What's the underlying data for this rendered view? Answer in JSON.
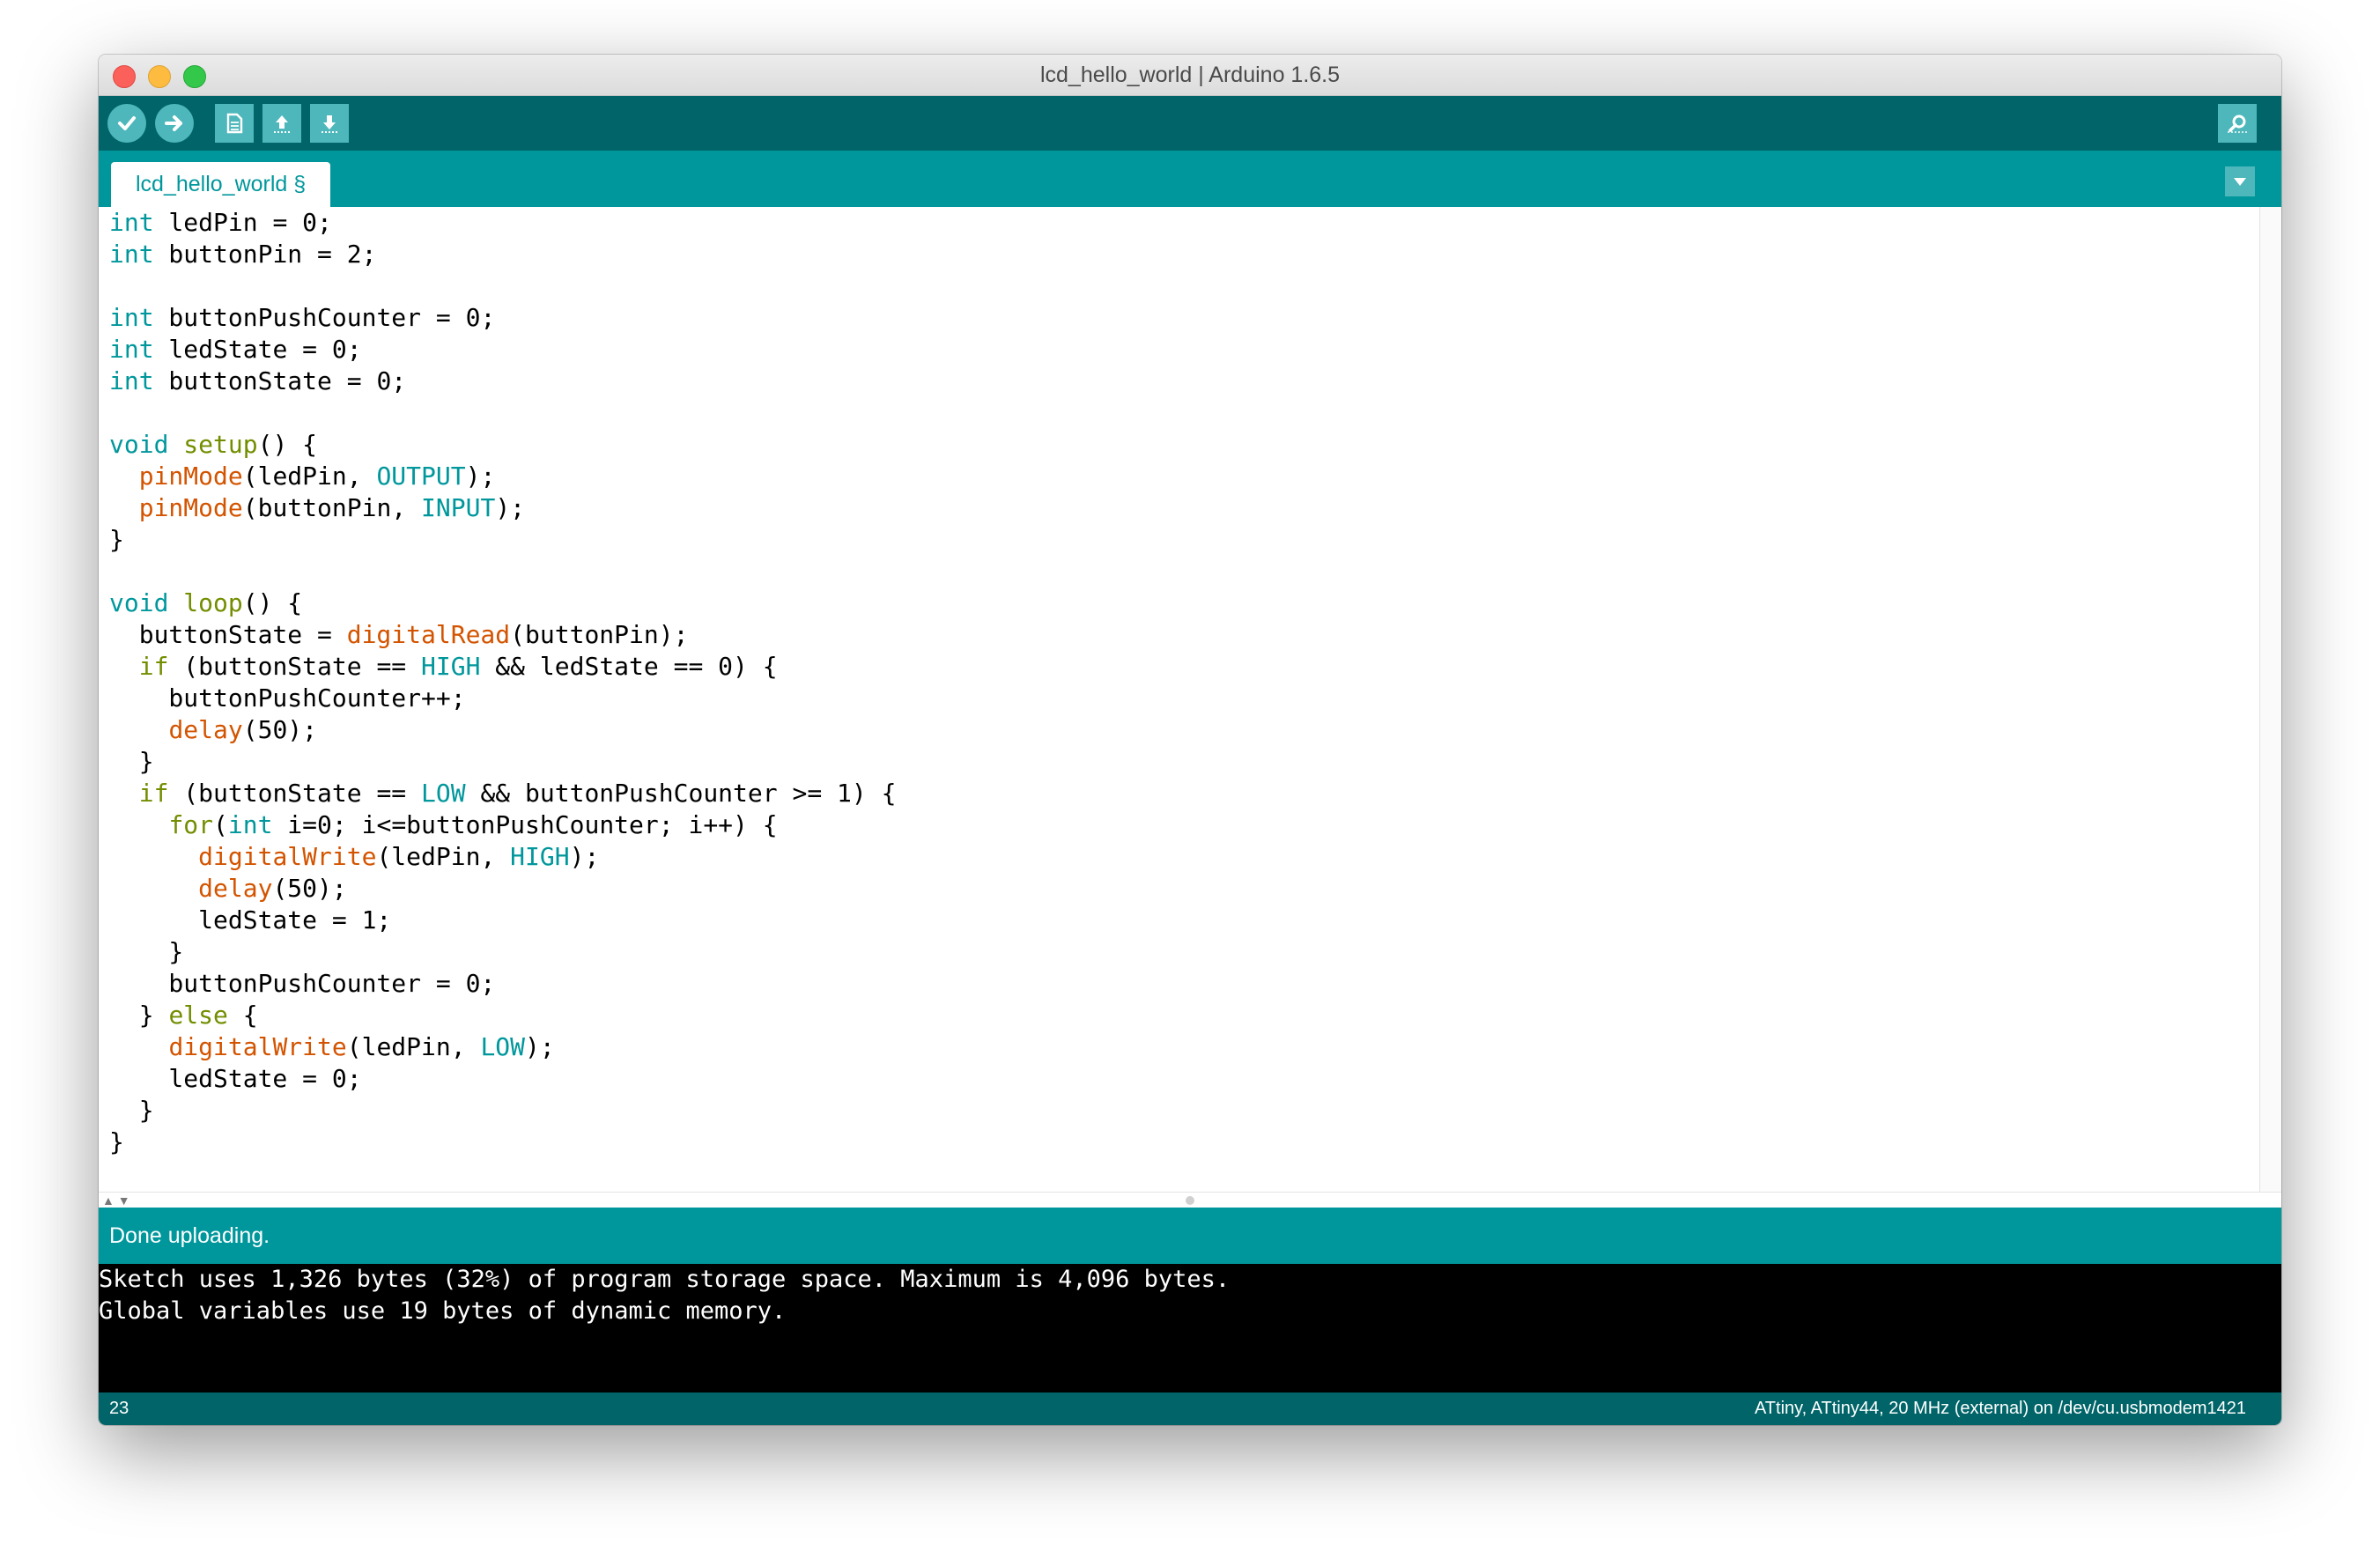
{
  "window": {
    "title": "lcd_hello_world | Arduino 1.6.5"
  },
  "tabs": [
    {
      "label": "lcd_hello_world §"
    }
  ],
  "toolbar": {
    "buttons": [
      {
        "name": "verify",
        "icon": "check-icon"
      },
      {
        "name": "upload",
        "icon": "arrow-right-icon"
      },
      {
        "name": "new",
        "icon": "new-file-icon"
      },
      {
        "name": "open",
        "icon": "arrow-up-icon"
      },
      {
        "name": "save",
        "icon": "arrow-down-icon"
      },
      {
        "name": "serial-monitor",
        "icon": "magnifier-icon"
      }
    ]
  },
  "code": {
    "lines": [
      "int ledPin = 0;",
      "int buttonPin = 2;",
      "",
      "int buttonPushCounter = 0;",
      "int ledState = 0;",
      "int buttonState = 0;",
      "",
      "void setup() {",
      "  pinMode(ledPin, OUTPUT);",
      "  pinMode(buttonPin, INPUT);",
      "}",
      "",
      "void loop() {",
      "  buttonState = digitalRead(buttonPin);",
      "  if (buttonState == HIGH && ledState == 0) {",
      "    buttonPushCounter++;",
      "    delay(50);",
      "  }",
      "  if (buttonState == LOW && buttonPushCounter >= 1) {",
      "    for(int i=0; i<=buttonPushCounter; i++) {",
      "      digitalWrite(ledPin, HIGH);",
      "      delay(50);",
      "      ledState = 1;",
      "    }",
      "    buttonPushCounter = 0;",
      "  } else {",
      "    digitalWrite(ledPin, LOW);",
      "    ledState = 0;",
      "  }",
      "}"
    ]
  },
  "status": {
    "message": "Done uploading."
  },
  "console": {
    "lines": [
      "Sketch uses 1,326 bytes (32%) of program storage space. Maximum is 4,096 bytes.",
      "Global variables use 19 bytes of dynamic memory."
    ]
  },
  "footer": {
    "line_number": "23",
    "board": "ATtiny, ATtiny44, 20 MHz (external) on /dev/cu.usbmodem1421"
  },
  "colors": {
    "toolbar": "#006468",
    "accent": "#00979c",
    "button": "#4db7bb",
    "keyword": "#00979c",
    "function": "#d35400",
    "control": "#728e00"
  }
}
